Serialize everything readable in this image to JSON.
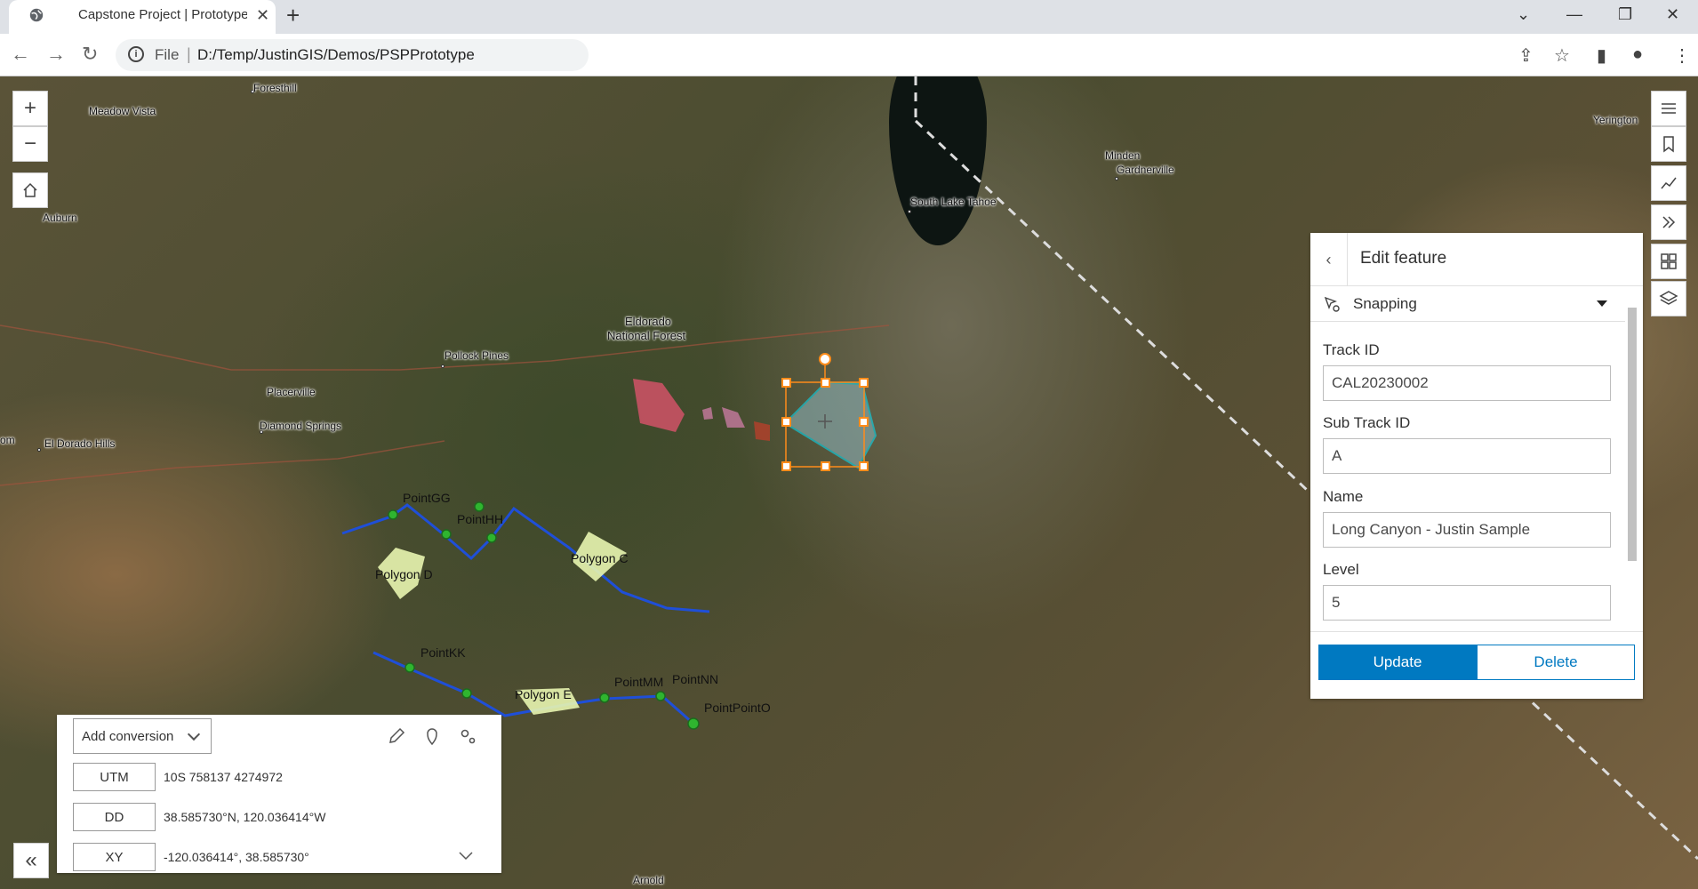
{
  "browser": {
    "tab_title": "Capstone Project | Prototype",
    "url_scheme": "File",
    "url_path": "D:/Temp/JustinGIS/Demos/PSPPrototype"
  },
  "map": {
    "places": [
      {
        "name": "Foresthill"
      },
      {
        "name": "Meadow Vista"
      },
      {
        "name": "Auburn"
      },
      {
        "name": "Pollock Pines"
      },
      {
        "name": "Placerville"
      },
      {
        "name": "Diamond Springs"
      },
      {
        "name": "El Dorado Hills"
      },
      {
        "name": "Eldorado"
      },
      {
        "name": "National Forest"
      },
      {
        "name": "South Lake Tahoe"
      },
      {
        "name": "Minden"
      },
      {
        "name": "Gardnerville"
      },
      {
        "name": "Yerington"
      },
      {
        "name": "Arnold"
      },
      {
        "name": "om"
      }
    ],
    "feature_labels": [
      "PointGG",
      "PointHH",
      "Polygon D",
      "Polygon C",
      "PointKK",
      "Polygon E",
      "PointMM",
      "PointNN",
      "PointPointO"
    ]
  },
  "edit_panel": {
    "title": "Edit feature",
    "snapping_label": "Snapping",
    "fields": [
      {
        "label": "Track ID",
        "value": "CAL20230002"
      },
      {
        "label": "Sub Track ID",
        "value": "A"
      },
      {
        "label": "Name",
        "value": "Long Canyon - Justin Sample"
      },
      {
        "label": "Level",
        "value": "5"
      }
    ],
    "update_label": "Update",
    "delete_label": "Delete"
  },
  "coordinates": {
    "add_conversion_label": "Add conversion",
    "rows": [
      {
        "label": "UTM",
        "value": "10S 758137 4274972"
      },
      {
        "label": "DD",
        "value": "38.585730°N, 120.036414°W"
      },
      {
        "label": "XY",
        "value": "-120.036414°, 38.585730°"
      }
    ]
  },
  "colors": {
    "accent": "#0079c1",
    "track_line": "#1f4fd8",
    "selected_polygon": "#00e5ff",
    "selection_handles": "#ff8c1a"
  }
}
